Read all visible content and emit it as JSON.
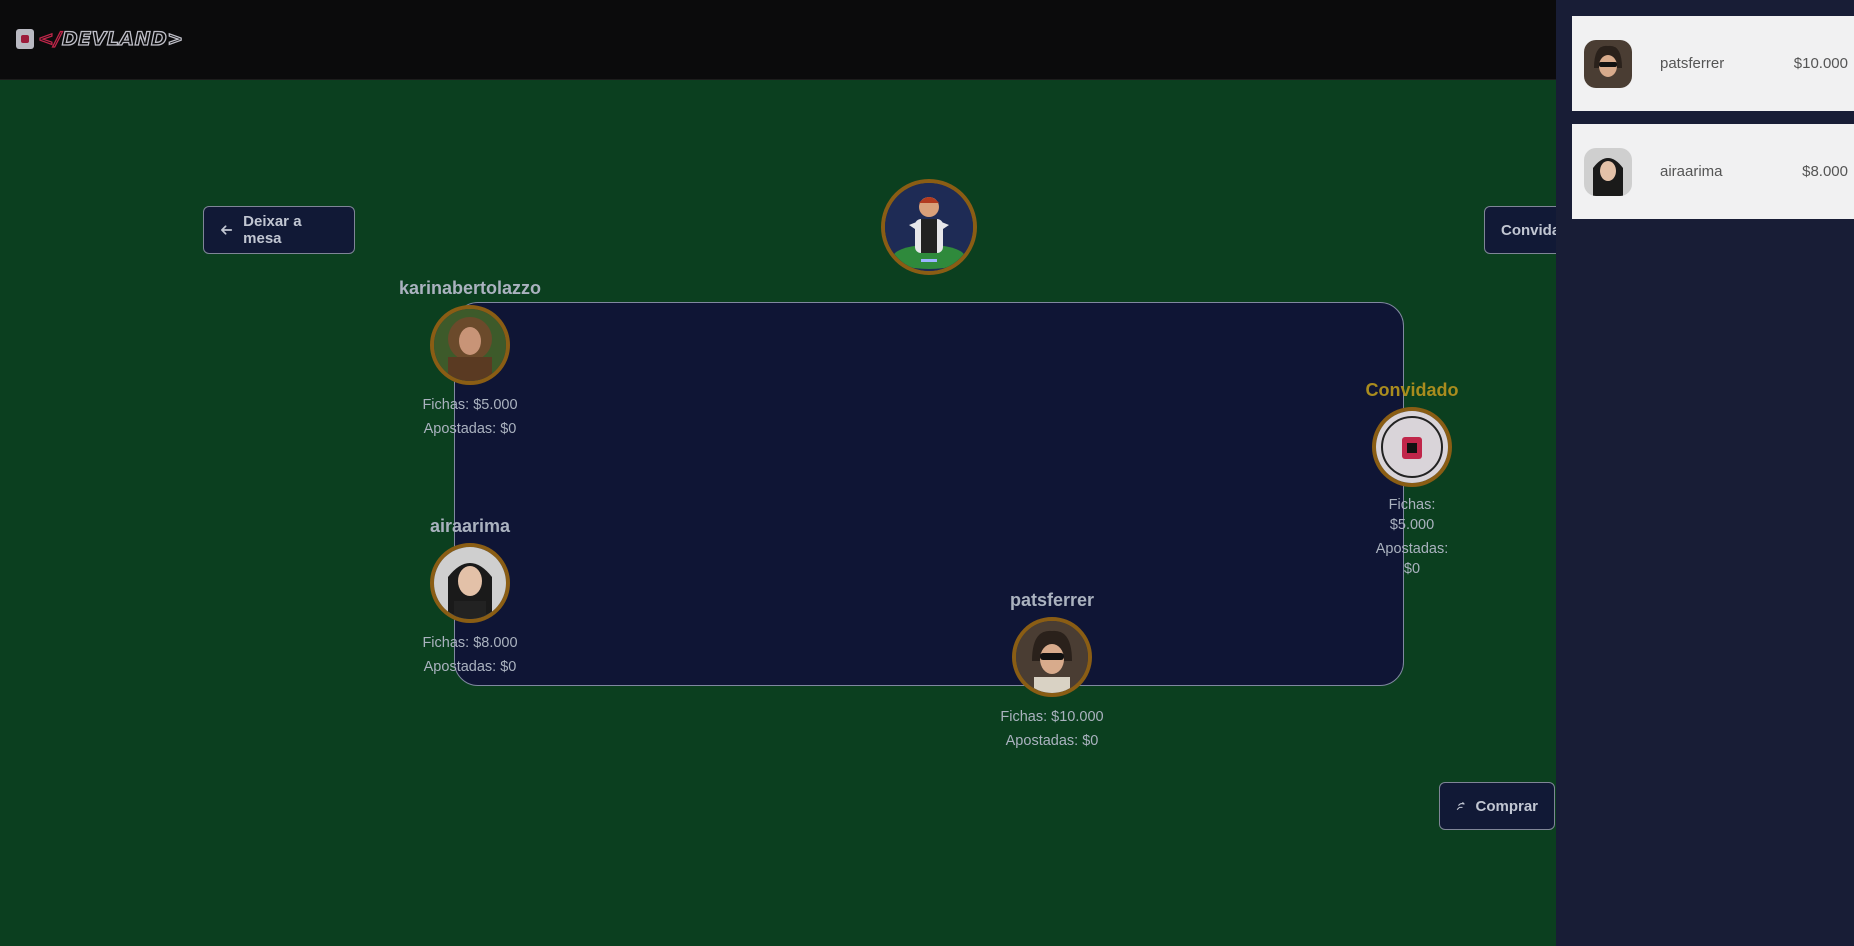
{
  "header": {
    "logo_prefix": "</",
    "logo_name": "DEVLAND>"
  },
  "actions": {
    "leave": "Deixar a mesa",
    "invite": "Convida",
    "buy": "Comprar"
  },
  "players": [
    {
      "name": "karinabertolazzo",
      "fichas": "Fichas: $5.000",
      "apostadas": "Apostadas: $0"
    },
    {
      "name": "airaarima",
      "fichas": "Fichas: $8.000",
      "apostadas": "Apostadas: $0"
    },
    {
      "name": "patsferrer",
      "fichas": "Fichas: $10.000",
      "apostadas": "Apostadas: $0"
    },
    {
      "name": "Convidado",
      "fichas_1": "Fichas:",
      "fichas_2": "$5.000",
      "apostadas_1": "Apostadas:",
      "apostadas_2": "$0"
    }
  ],
  "leaderboard": [
    {
      "name": "patsferrer",
      "amount": "$10.000"
    },
    {
      "name": "airaarima",
      "amount": "$8.000"
    }
  ],
  "colors": {
    "felt": "#0b3f1f",
    "table": "#0f1535",
    "ring": "#8a5d14",
    "guest": "#a98c1e",
    "panel": "#181d36"
  }
}
